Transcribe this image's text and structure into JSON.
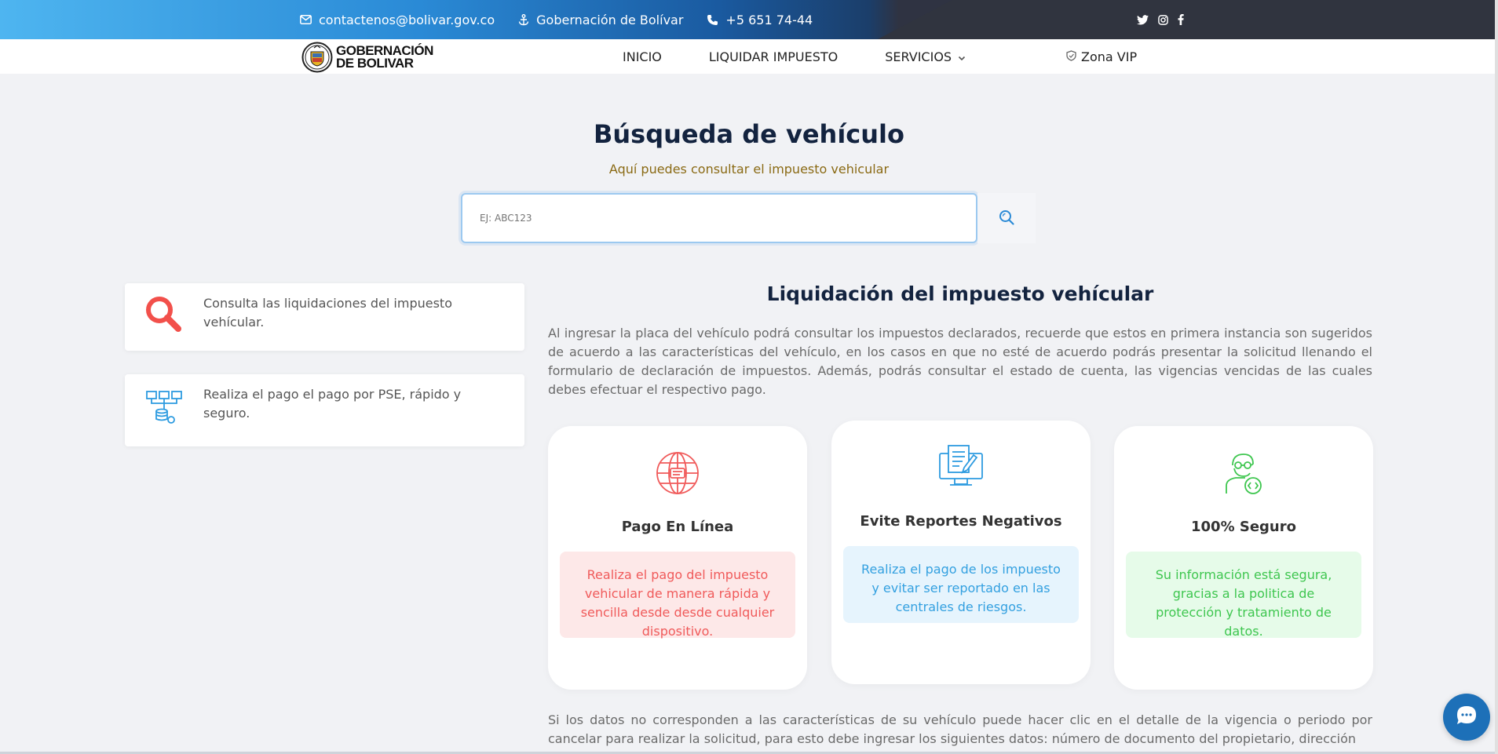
{
  "topbar": {
    "email": "contactenos@bolivar.gov.co",
    "org": "Gobernación de Bolívar",
    "phone": "+5 651 74-44",
    "social_icons": [
      "twitter-icon",
      "instagram-icon",
      "facebook-icon"
    ]
  },
  "nav": {
    "logo_line1": "GOBERNACIÓN",
    "logo_line2": "DE BOLIVAR",
    "items": [
      "INICIO",
      "LIQUIDAR IMPUESTO",
      "SERVICIOS"
    ],
    "zona_vip": "Zona VIP"
  },
  "search": {
    "title": "Búsqueda de vehículo",
    "subtitle": "Aquí puedes consultar el impuesto vehicular",
    "placeholder": "EJ: ABC123",
    "value": ""
  },
  "features": [
    {
      "icon": "search-icon",
      "text": "Consulta las liquidaciones del impuesto vehícular."
    },
    {
      "icon": "network-icon",
      "text": "Realiza el pago el pago por PSE, rápido y seguro."
    }
  ],
  "section": {
    "title": "Liquidación del impuesto vehícular",
    "paragraph1": "Al ingresar la placa del vehículo podrá consultar los impuestos declarados, recuerde que estos en primera instancia son sugeridos de acuerdo a las características del vehículo, en los casos en que no esté de acuerdo podrás presentar la solicitud llenando el formulario de declaración de impuestos. Además, podrás consultar el estado de cuenta, las vigencias vencidas de las cuales debes efectuar el respectivo pago.",
    "paragraph2": "Si los datos no corresponden a las características de su vehículo puede hacer clic en el detalle de la vigencia o periodo por cancelar para realizar la solicitud, para esto debe ingresar los siguientes datos: número de documento del propietario, dirección"
  },
  "cards": [
    {
      "title": "Pago En Línea",
      "text": "Realiza el pago del impuesto vehicular de manera rápida y sencilla desde desde cualquier dispositivo.",
      "color": "#f05a5a"
    },
    {
      "title": "Evite Reportes Negativos",
      "text": "Realiza el pago de los impuesto y evitar ser reportado en las centrales de riesgos.",
      "color": "#33a0e0"
    },
    {
      "title": "100% Seguro",
      "text": "Su información está segura, gracias a la politica de protección y tratamiento de datos.",
      "color": "#3ec64f"
    }
  ]
}
